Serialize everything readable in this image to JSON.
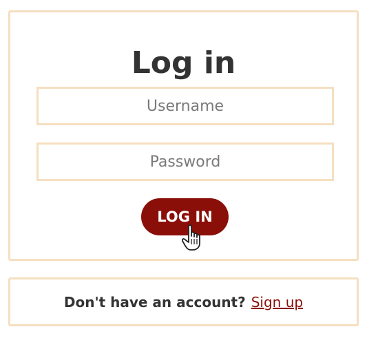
{
  "login": {
    "title": "Log in",
    "username_placeholder": "Username",
    "password_placeholder": "Password",
    "button_label": "LOG IN"
  },
  "signup": {
    "prompt": "Don't have an account?",
    "link_label": "Sign up"
  },
  "colors": {
    "border": "#f5dfc0",
    "accent": "#8a0f08",
    "text": "#333333"
  },
  "icons": {
    "cursor": "hand-pointer-icon"
  }
}
